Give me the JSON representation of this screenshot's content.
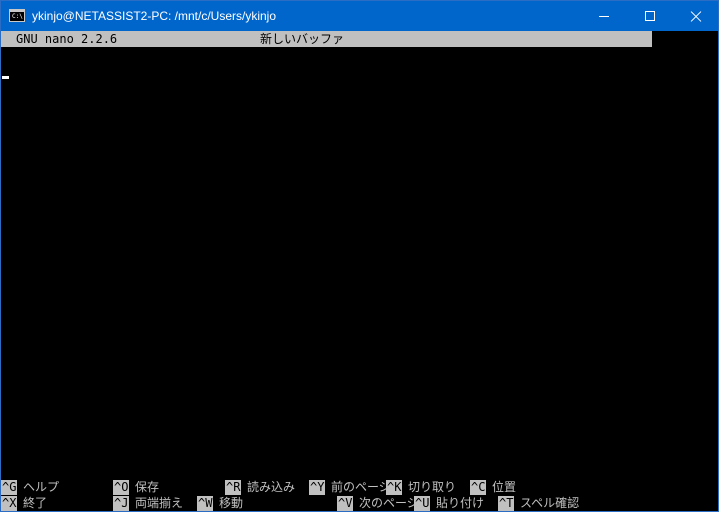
{
  "window": {
    "title": "ykinjo@NETASSIST2-PC: /mnt/c/Users/ykinjo",
    "icon": "console-icon",
    "icon_glyph": "C:\\"
  },
  "nano": {
    "version": "GNU nano 2.2.6",
    "buffer_name": "新しいバッファ"
  },
  "shortcuts_row1": [
    {
      "key": "^G",
      "label": "ヘルプ"
    },
    {
      "key": "^O",
      "label": "保存"
    },
    {
      "key": "^R",
      "label": "読み込み"
    },
    {
      "key": "^Y",
      "label": "前のページ"
    },
    {
      "key": "^K",
      "label": "切り取り"
    },
    {
      "key": "^C",
      "label": "位置"
    }
  ],
  "shortcuts_row2": [
    {
      "key": "^X",
      "label": "終了"
    },
    {
      "key": "^J",
      "label": "両端揃え"
    },
    {
      "key": "^W",
      "label": "移動"
    },
    {
      "key": "^V",
      "label": "次のページ"
    },
    {
      "key": "^U",
      "label": "貼り付け"
    },
    {
      "key": "^T",
      "label": "スペル確認"
    }
  ],
  "colors": {
    "titlebar": "#0066cc",
    "terminal_bg": "#000000",
    "terminal_fg": "#c0c0c0",
    "highlight_bg": "#c0c0c0"
  }
}
